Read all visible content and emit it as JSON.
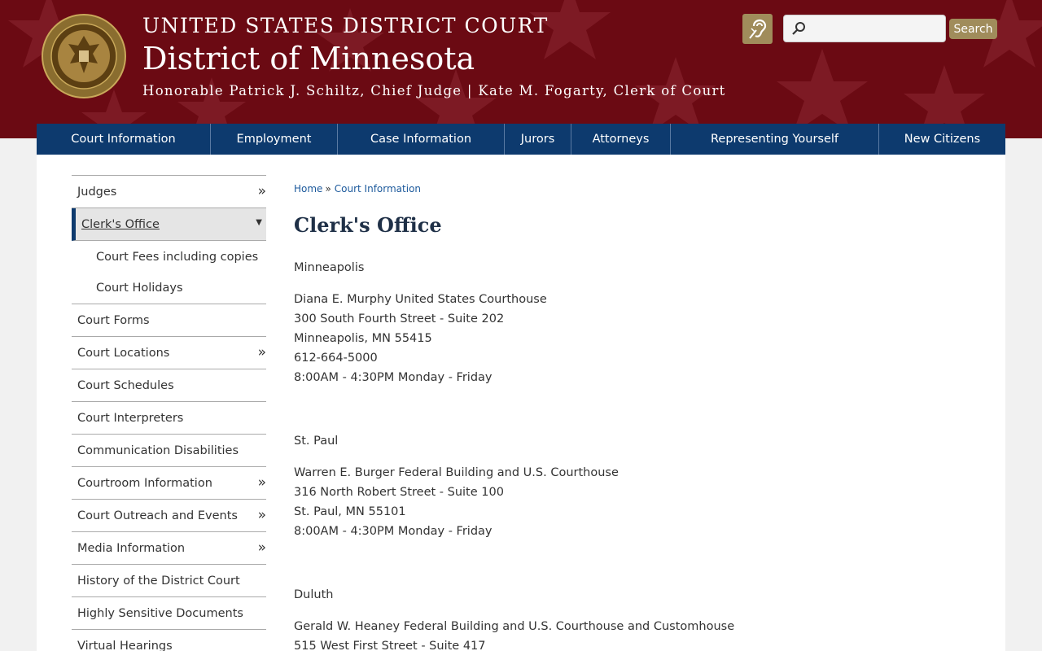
{
  "header": {
    "court": "UNITED STATES DISTRICT COURT",
    "district": "District of Minnesota",
    "officials": "Honorable Patrick J. Schiltz, Chief Judge | Kate M. Fogarty, Clerk of Court",
    "search_placeholder": "",
    "search_button": "Search",
    "colors": {
      "header_bg": "#6b0a13",
      "accent_gold": "#a08c5b",
      "nav_bg": "#0d3a6e"
    }
  },
  "nav": [
    {
      "label": "Court Information"
    },
    {
      "label": "Employment"
    },
    {
      "label": "Case Information"
    },
    {
      "label": "Jurors"
    },
    {
      "label": "Attorneys"
    },
    {
      "label": "Representing Yourself"
    },
    {
      "label": "New Citizens"
    }
  ],
  "sidebar": {
    "items": [
      {
        "label": "Judges",
        "arrow": "»"
      },
      {
        "label": "Clerk's Office",
        "caret": "▼"
      },
      {
        "label": "Court Forms"
      },
      {
        "label": "Court Locations",
        "arrow": "»"
      },
      {
        "label": "Court Schedules"
      },
      {
        "label": "Court Interpreters"
      },
      {
        "label": "Communication Disabilities"
      },
      {
        "label": "Courtroom Information",
        "arrow": "»"
      },
      {
        "label": "Court Outreach and Events",
        "arrow": "»"
      },
      {
        "label": "Media Information",
        "arrow": "»"
      },
      {
        "label": "History of the District Court"
      },
      {
        "label": "Highly Sensitive Documents"
      },
      {
        "label": "Virtual Hearings"
      }
    ],
    "subitems": [
      {
        "label": "Court Fees including copies"
      },
      {
        "label": "Court Holidays"
      }
    ]
  },
  "breadcrumb": {
    "home": "Home",
    "sep": "»",
    "current": "Court Information"
  },
  "page_title": "Clerk's Office",
  "locations": [
    {
      "city": "Minneapolis",
      "lines": [
        "Diana E. Murphy United States Courthouse",
        "300 South Fourth Street - Suite 202",
        "Minneapolis, MN 55415",
        "612-664-5000",
        "8:00AM - 4:30PM Monday - Friday"
      ]
    },
    {
      "city": "St. Paul",
      "lines": [
        "Warren E. Burger Federal Building and U.S. Courthouse",
        "316 North Robert Street - Suite 100",
        "St. Paul, MN 55101",
        "8:00AM - 4:30PM Monday - Friday"
      ]
    },
    {
      "city": "Duluth",
      "lines": [
        "Gerald W. Heaney Federal Building and U.S. Courthouse and Customhouse",
        "515 West First Street - Suite 417"
      ]
    }
  ]
}
